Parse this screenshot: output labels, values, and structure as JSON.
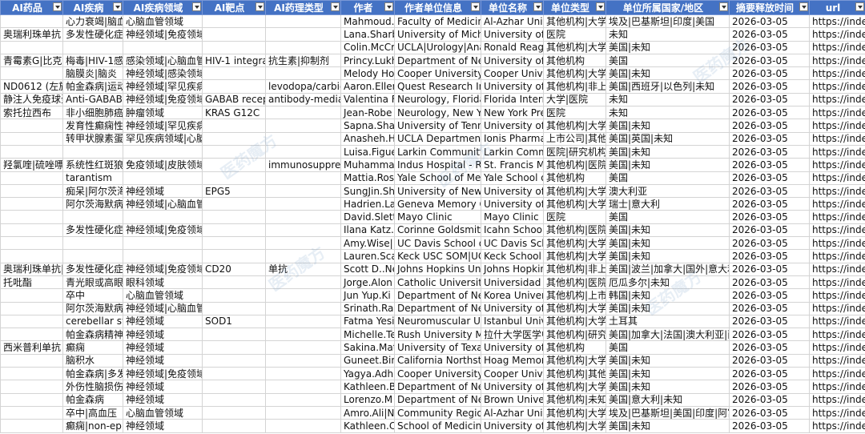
{
  "headers": [
    "AI药品",
    "AI疾病",
    "AI疾病领域",
    "AI靶点",
    "AI药理类型",
    "作者",
    "作者单位信息",
    "单位名称",
    "单位类型",
    "单位所属国家/地区",
    "摘要释放时间",
    "url"
  ],
  "watermark": "医药魔方",
  "rows": [
    [
      "",
      "心力衰竭|脑血",
      "心脑血管领域",
      "",
      "",
      "Mahmoud.",
      "Faculty of Medicine",
      "Al-Azhar Univ",
      "其他机构|大学|",
      "埃及|巴基斯坦|印度|美国",
      "2026-03-05",
      "https://inde"
    ],
    [
      "奥瑞利珠单抗",
      "多发性硬化症",
      "神经领域|免疫领域",
      "",
      "",
      "Lana.Sharb",
      "University of Michi",
      "University of",
      "医院",
      "未知",
      "2026-03-05",
      "https://inde"
    ],
    [
      "",
      "",
      "",
      "",
      "",
      "Colin.McCr",
      "UCLA|Urology|Anal",
      "Ronald Reag",
      "其他机构|大学|",
      "美国|未知",
      "2026-03-05",
      "https://inde"
    ],
    [
      "青霉素G|比克",
      "梅毒|HIV-1感染",
      "感染领域|心脑血管",
      "HIV-1 integra",
      "抗生素|抑制剂",
      "Princy.Lukh",
      "Department of Neu",
      "University of",
      "其他机构",
      "美国",
      "2026-03-05",
      "https://inde"
    ],
    [
      "",
      "脑膜炎|脑炎",
      "神经领域|感染领域",
      "",
      "",
      "Melody Ho",
      "Cooper University",
      "Cooper Unive",
      "其他机构|大学",
      "美国|未知",
      "2026-03-05",
      "https://inde"
    ],
    [
      "ND0612 (左旋",
      "帕金森病|运动",
      "神经领域|罕见疾病",
      "",
      "levodopa/carbic",
      "Aaron.Eller",
      "Quest Research Ins",
      "University of",
      "其他机构|非上市",
      "美国|西班牙|以色列|未知",
      "2026-03-05",
      "https://inde"
    ],
    [
      "静注人免疫球蛋",
      "Anti-GABABR",
      "神经领域|免疫领域",
      "GABAB recept",
      "antibody-media",
      "Valentina F",
      "Neurology, Florida",
      "Florida Intern",
      "大学|医院",
      "未知",
      "2026-03-05",
      "https://inde"
    ],
    [
      "索托拉西布",
      "非小细胞肺癌",
      "肿瘤领域",
      "KRAS G12C",
      "",
      "Jean-Robe",
      "Neurology, New Yo",
      "New York Pre",
      "医院",
      "未知",
      "2026-03-05",
      "https://inde"
    ],
    [
      "",
      "发育性癫痫性",
      "神经领域|罕见疾病",
      "",
      "",
      "Sapna.Shal",
      "University of Tenne",
      "University of",
      "其他机构|大学",
      "美国|未知",
      "2026-03-05",
      "https://inde"
    ],
    [
      "",
      "转甲状腺素蛋",
      "罕见疾病领域|心脑",
      "",
      "",
      "Anasheh.H",
      "UCLA Department",
      "Ionis Pharmac",
      "上市公司|其他",
      "美国|英国|未知",
      "2026-03-05",
      "https://inde"
    ],
    [
      "",
      "",
      "",
      "",
      "",
      "Luisa.Figue",
      "Larkin Community",
      "Larkin Comm",
      "医院|研究机构",
      "美国|未知",
      "2026-03-05",
      "https://inde"
    ],
    [
      "羟氯喹|硫唑嘌",
      "系统性红斑狼",
      "免疫领域|皮肤领域",
      "",
      "immunosuppres",
      "Muhamma",
      "Indus Hospital - Re",
      "St. Francis Me",
      "其他机构|医院",
      "美国|未知",
      "2026-03-05",
      "https://inde"
    ],
    [
      "",
      "tarantism",
      "",
      "",
      "",
      "Mattia.Ros",
      "Yale School of Med",
      "Yale School o",
      "其他机构",
      "美国",
      "2026-03-05",
      "https://inde"
    ],
    [
      "",
      "痴呆|阿尔茨海",
      "神经领域",
      "EPG5",
      "",
      "SungJin.Sh",
      "University of New E",
      "University of",
      "其他机构|大学",
      "澳大利亚",
      "2026-03-05",
      "https://inde"
    ],
    [
      "",
      "阿尔茨海默病|",
      "神经领域|心脑血管",
      "",
      "",
      "Hadrien.La",
      "Geneva Memory Ce",
      "University of",
      "其他机构|大学",
      "瑞士|意大利",
      "2026-03-05",
      "https://inde"
    ],
    [
      "",
      "",
      "",
      "",
      "",
      "David.Slett",
      "Mayo Clinic",
      "Mayo Clinic",
      "医院",
      "美国",
      "2026-03-05",
      "https://inde"
    ],
    [
      "",
      "多发性硬化症",
      "神经领域|免疫领域",
      "",
      "",
      "Ilana Katz.S",
      "Corinne Goldsmith",
      "Icahn School",
      "其他机构|医院",
      "美国|未知",
      "2026-03-05",
      "https://inde"
    ],
    [
      "",
      "",
      "",
      "",
      "",
      "Amy.Wise|",
      "UC Davis School of",
      "UC Davis Sch",
      "其他机构|大学",
      "美国|未知",
      "2026-03-05",
      "https://inde"
    ],
    [
      "",
      "",
      "",
      "",
      "",
      "Lauren.Sca",
      "Keck USC SOM|UCI",
      "Keck School o",
      "其他机构|大学",
      "美国|未知",
      "2026-03-05",
      "https://inde"
    ],
    [
      "奥瑞利珠单抗|",
      "多发性硬化症",
      "神经领域|免疫领域",
      "CD20",
      "单抗",
      "Scott D..Ne",
      "Johns Hopkins Univ",
      "Johns Hopkin",
      "其他机构|非上市",
      "美国|波兰|加拿大|国外|意大利",
      "2026-03-05",
      "https://inde"
    ],
    [
      "托吡酯",
      "青光眼或高眼",
      "眼科领域",
      "",
      "",
      "Jorge.Alon",
      "Catholic University",
      "Universidad C",
      "其他机构|医院|",
      "厄瓜多尔|未知",
      "2026-03-05",
      "https://inde"
    ],
    [
      "",
      "卒中",
      "心脑血管领域",
      "",
      "",
      "Jun Yup.Ki",
      "Department of Neu",
      "Korea Univer",
      "其他机构|上市",
      "韩国|未知",
      "2026-03-05",
      "https://inde"
    ],
    [
      "",
      "阿尔茨海默病|",
      "神经领域|心脑血管",
      "",
      "",
      "Srinath.Ra",
      "Department of Neu",
      "University of",
      "其他机构|大学",
      "美国|未知",
      "2026-03-05",
      "https://inde"
    ],
    [
      "",
      "cerebellar syn",
      "神经领域",
      "SOD1",
      "",
      "Fatma Yesi",
      "Neuromuscular Uni",
      "Istanbul Univ",
      "其他机构|大学",
      "土耳其",
      "2026-03-05",
      "https://inde"
    ],
    [
      "",
      "帕金森病精神",
      "神经领域",
      "",
      "",
      "Michelle.Te",
      "Rush University Me",
      "拉什大学医学中",
      "其他机构|研究",
      "美国|加拿大|法国|澳大利亚|西",
      "2026-03-05",
      "https://inde"
    ],
    [
      "西米普利单抗",
      "癫痫",
      "神经领域",
      "",
      "",
      "Sakina.Mat",
      "University of Texas",
      "University of",
      "其他机构",
      "美国",
      "2026-03-05",
      "https://inde"
    ],
    [
      "",
      "脑积水",
      "神经领域",
      "",
      "",
      "Guneet.Bin",
      "California Northstat",
      "Hoag Memori",
      "其他机构|大学",
      "美国|未知",
      "2026-03-05",
      "https://inde"
    ],
    [
      "",
      "帕金森病|多发",
      "神经领域|免疫领域",
      "",
      "",
      "Yagya.Adh",
      "Cooper University",
      "Cooper Unive",
      "其他机构|其他",
      "美国|未知",
      "2026-03-05",
      "https://inde"
    ],
    [
      "",
      "外伤性脑损伤",
      "神经领域",
      "",
      "",
      "Kathleen.B",
      "Department of Neu",
      "University of",
      "其他机构|大学",
      "美国|未知",
      "2026-03-05",
      "https://inde"
    ],
    [
      "",
      "帕金森病",
      "神经领域",
      "",
      "",
      "Lorenzo.M",
      "Department of Neu",
      "Brown Univer",
      "其他机构|未知",
      "美国|意大利|未知",
      "2026-03-05",
      "https://inde"
    ],
    [
      "",
      "卒中|高血压",
      "心脑血管领域",
      "",
      "",
      "Amro.Ali|N",
      "Community Region",
      "Al-Azhar Univ",
      "其他机构|大学|",
      "埃及|巴基斯坦|美国|印度|阿富",
      "2026-03-05",
      "https://inde"
    ],
    [
      "",
      "癫痫|non-epil",
      "神经领域",
      "",
      "",
      "Kathleen.C",
      "School of Medicine",
      "University of",
      "其他机构|大学",
      "美国|未知",
      "2026-03-05",
      "https://inde"
    ]
  ]
}
